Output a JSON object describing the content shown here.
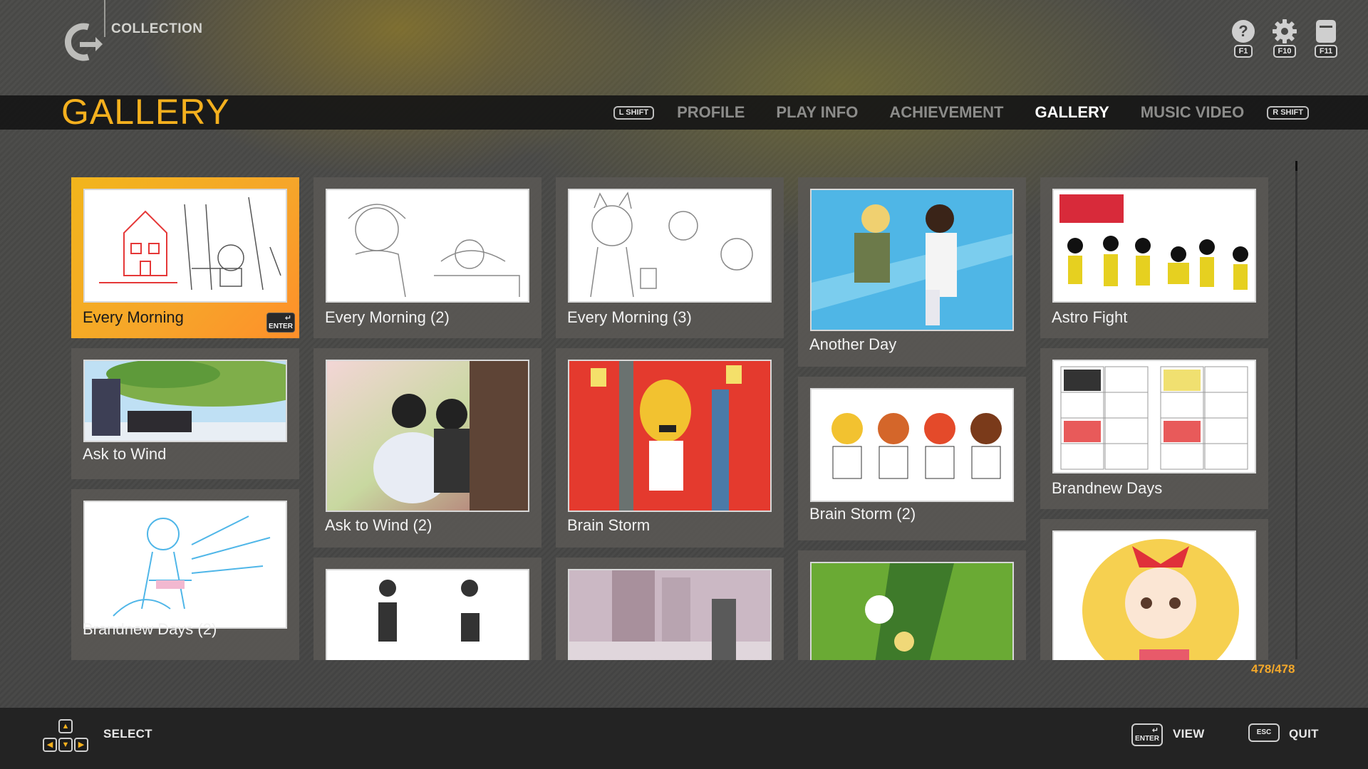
{
  "header": {
    "section_label": "COLLECTION",
    "system_buttons": [
      {
        "icon": "help-icon",
        "key": "F1"
      },
      {
        "icon": "gear-icon",
        "key": "F10"
      },
      {
        "icon": "exit-icon",
        "key": "F11"
      }
    ]
  },
  "nav": {
    "title": "GALLERY",
    "prev_key": "L SHIFT",
    "next_key": "R SHIFT",
    "tabs": [
      "PROFILE",
      "PLAY INFO",
      "ACHIEVEMENT",
      "GALLERY",
      "MUSIC VIDEO"
    ],
    "active_tab": "GALLERY"
  },
  "gallery": {
    "enter_label": "ENTER",
    "items": [
      {
        "title": "Every Morning",
        "selected": true
      },
      {
        "title": "Every Morning (2)"
      },
      {
        "title": "Every Morning (3)"
      },
      {
        "title": "Another Day"
      },
      {
        "title": "Astro Fight"
      },
      {
        "title": "Ask to Wind"
      },
      {
        "title": "Ask to Wind (2)"
      },
      {
        "title": "Brain Storm"
      },
      {
        "title": "Brain Storm (2)"
      },
      {
        "title": "Brandnew Days"
      },
      {
        "title": "Brandnew Days (2)"
      }
    ],
    "counter": "478/478",
    "accent_color": "#f4b01e"
  },
  "footer": {
    "select_label": "SELECT",
    "view_key": "ENTER",
    "view_label": "VIEW",
    "quit_key": "ESC",
    "quit_label": "QUIT"
  }
}
